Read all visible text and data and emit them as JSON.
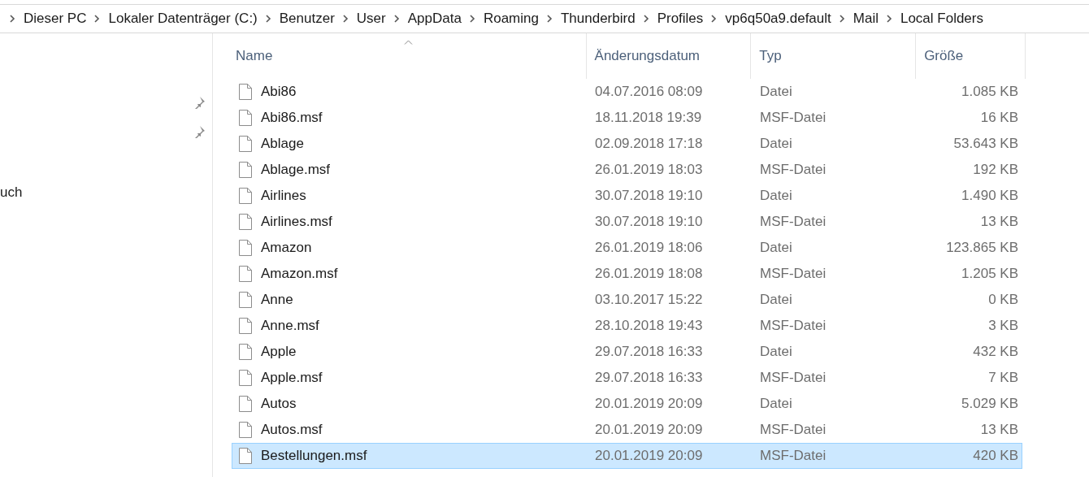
{
  "breadcrumb": [
    "Dieser PC",
    "Lokaler Datenträger (C:)",
    "Benutzer",
    "User",
    "AppData",
    "Roaming",
    "Thunderbird",
    "Profiles",
    "vp6q50a9.default",
    "Mail",
    "Local Folders"
  ],
  "navigation": {
    "items": [
      {
        "label": "uch"
      }
    ]
  },
  "table": {
    "columns": [
      "Name",
      "Änderungsdatum",
      "Typ",
      "Größe"
    ],
    "rows": [
      {
        "name": "Abi86",
        "date": "04.07.2016 08:09",
        "type": "Datei",
        "size": "1.085 KB",
        "selected": false
      },
      {
        "name": "Abi86.msf",
        "date": "18.11.2018 19:39",
        "type": "MSF-Datei",
        "size": "16 KB",
        "selected": false
      },
      {
        "name": "Ablage",
        "date": "02.09.2018 17:18",
        "type": "Datei",
        "size": "53.643 KB",
        "selected": false
      },
      {
        "name": "Ablage.msf",
        "date": "26.01.2019 18:03",
        "type": "MSF-Datei",
        "size": "192 KB",
        "selected": false
      },
      {
        "name": "Airlines",
        "date": "30.07.2018 19:10",
        "type": "Datei",
        "size": "1.490 KB",
        "selected": false
      },
      {
        "name": "Airlines.msf",
        "date": "30.07.2018 19:10",
        "type": "MSF-Datei",
        "size": "13 KB",
        "selected": false
      },
      {
        "name": "Amazon",
        "date": "26.01.2019 18:06",
        "type": "Datei",
        "size": "123.865 KB",
        "selected": false
      },
      {
        "name": "Amazon.msf",
        "date": "26.01.2019 18:08",
        "type": "MSF-Datei",
        "size": "1.205 KB",
        "selected": false
      },
      {
        "name": "Anne",
        "date": "03.10.2017 15:22",
        "type": "Datei",
        "size": "0 KB",
        "selected": false
      },
      {
        "name": "Anne.msf",
        "date": "28.10.2018 19:43",
        "type": "MSF-Datei",
        "size": "3 KB",
        "selected": false
      },
      {
        "name": "Apple",
        "date": "29.07.2018 16:33",
        "type": "Datei",
        "size": "432 KB",
        "selected": false
      },
      {
        "name": "Apple.msf",
        "date": "29.07.2018 16:33",
        "type": "MSF-Datei",
        "size": "7 KB",
        "selected": false
      },
      {
        "name": "Autos",
        "date": "20.01.2019 20:09",
        "type": "Datei",
        "size": "5.029 KB",
        "selected": false
      },
      {
        "name": "Autos.msf",
        "date": "20.01.2019 20:09",
        "type": "MSF-Datei",
        "size": "13 KB",
        "selected": false
      },
      {
        "name": "Bestellungen.msf",
        "date": "20.01.2019 20:09",
        "type": "MSF-Datei",
        "size": "420 KB",
        "selected": true
      }
    ]
  }
}
